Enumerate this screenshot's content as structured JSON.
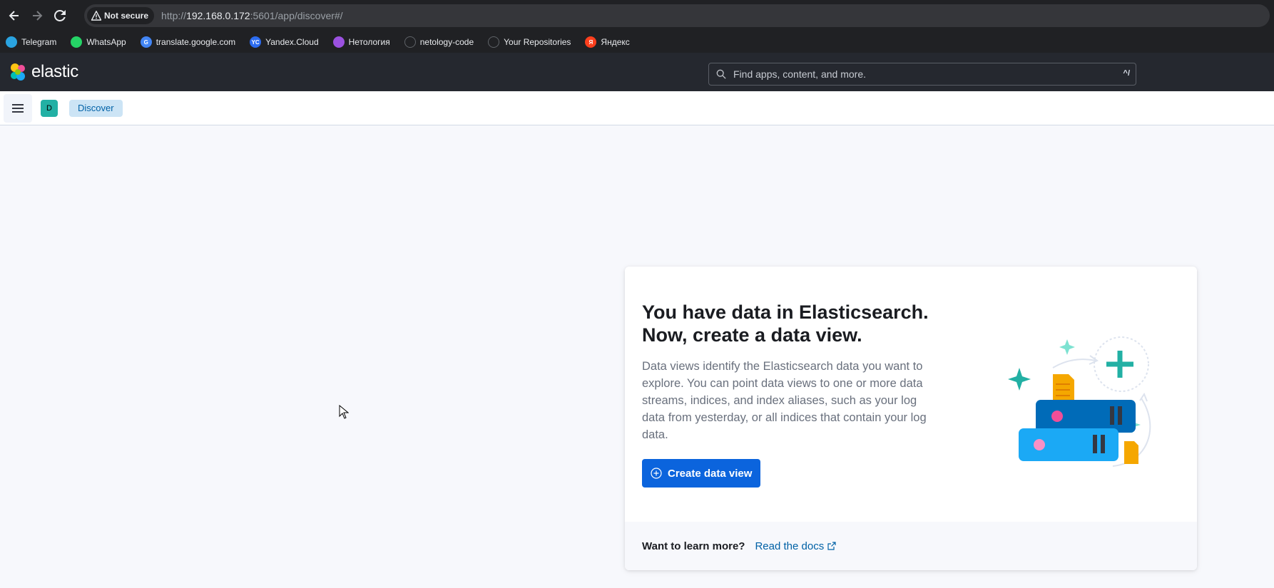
{
  "browser": {
    "security_label": "Not secure",
    "url_scheme": "http://",
    "url_host": "192.168.0.172",
    "url_rest": ":5601/app/discover#/"
  },
  "bookmarks": [
    {
      "label": "Telegram",
      "icon": "telegram-icon",
      "color": "#2aa3e0",
      "glyph": ""
    },
    {
      "label": "WhatsApp",
      "icon": "whatsapp-icon",
      "color": "#25d366",
      "glyph": ""
    },
    {
      "label": "translate.google.com",
      "icon": "google-translate-icon",
      "color": "#4285f4",
      "glyph": "G"
    },
    {
      "label": "Yandex.Cloud",
      "icon": "yandex-cloud-icon",
      "color": "#2c6cf0",
      "glyph": "YC"
    },
    {
      "label": "Нетология",
      "icon": "netology-icon",
      "color": "#9b51e0",
      "glyph": ""
    },
    {
      "label": "netology-code",
      "icon": "github-icon",
      "color": "#202124",
      "glyph": ""
    },
    {
      "label": "Your Repositories",
      "icon": "github-icon",
      "color": "#202124",
      "glyph": ""
    },
    {
      "label": "Яндекс",
      "icon": "yandex-icon",
      "color": "#fc3f1d",
      "glyph": "Я"
    }
  ],
  "header": {
    "logo_text": "elastic",
    "search_placeholder": "Find apps, content, and more.",
    "search_shortcut": "^/"
  },
  "subheader": {
    "space_initial": "D",
    "breadcrumb": "Discover"
  },
  "card": {
    "title": "You have data in Elasticsearch. Now, create a data view.",
    "description": "Data views identify the Elasticsearch data you want to explore. You can point data views to one or more data streams, indices, and index aliases, such as your log data from yesterday, or all indices that contain your log data.",
    "button_label": "Create data view",
    "footer_label": "Want to learn more?",
    "docs_link": "Read the docs"
  },
  "colors": {
    "accent": "#0b64dd",
    "header_bg": "#25282f",
    "space_avatar": "#22b0a4",
    "breadcrumb_bg": "#cce4f5"
  }
}
